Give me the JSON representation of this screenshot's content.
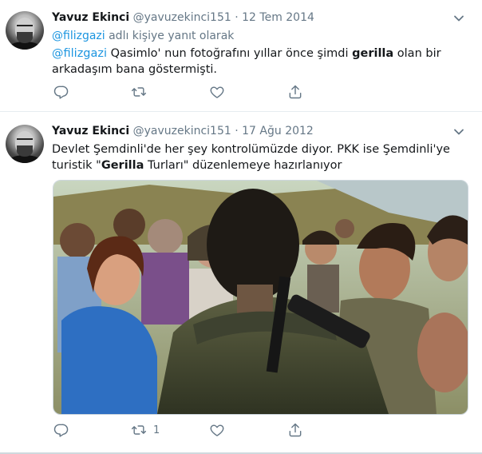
{
  "tweets": [
    {
      "name": "Yavuz Ekinci",
      "handle": "@yavuzekinci151",
      "separator": "·",
      "date": "12 Tem 2014",
      "reply_mention": "@filizgazi",
      "reply_suffix": " adlı kişiye yanıt olarak",
      "text_mention": "@filizgazi",
      "text_part1": " Qasimlo' nun fotoğrafını yıllar önce şimdi ",
      "text_bold": "gerilla",
      "text_part2": " olan bir arkadaşım bana göstermişti.",
      "actions": {
        "reply_count": "",
        "retweet_count": "",
        "like_count": ""
      }
    },
    {
      "name": "Yavuz Ekinci",
      "handle": "@yavuzekinci151",
      "separator": "·",
      "date": "17 Ağu 2012",
      "text_part1": "Devlet Şemdinli'de her şey kontrolümüzde diyor. PKK ise Şemdinli'ye turistik \"",
      "text_bold": "Gerilla",
      "text_part2": " Turları\" düzenlemeye hazırlanıyor",
      "actions": {
        "reply_count": "",
        "retweet_count": "1",
        "like_count": ""
      }
    }
  ],
  "icons": [
    "reply-icon",
    "retweet-icon",
    "like-icon",
    "share-icon",
    "chevron-down-icon"
  ],
  "colors": {
    "link": "#1b95e0",
    "secondary_text": "#657786",
    "divider": "#e6ecf0",
    "icon": "#657786"
  }
}
